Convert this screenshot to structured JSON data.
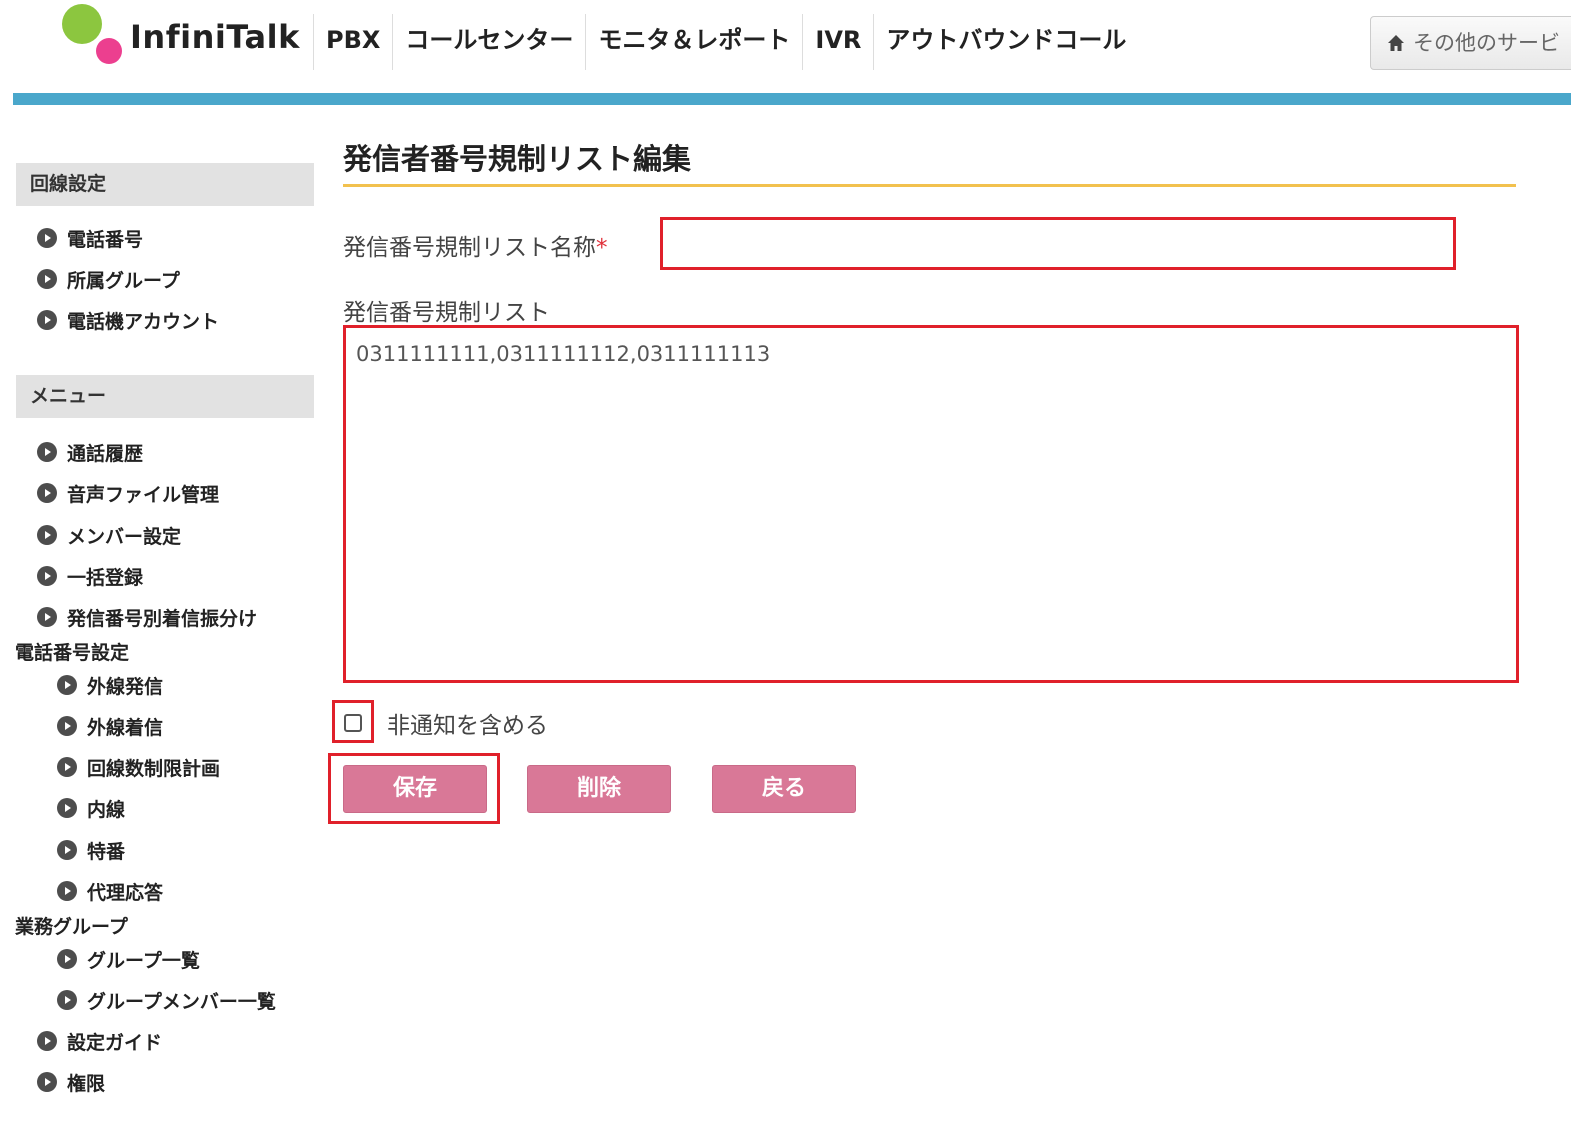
{
  "header": {
    "logo_text": "InfiniTalk",
    "nav": [
      "PBX",
      "コールセンター",
      "モニタ＆レポート",
      "IVR",
      "アウトバウンドコール"
    ],
    "service_button": "その他のサービ"
  },
  "sidebar": {
    "section1": {
      "title": "回線設定",
      "items": [
        "電話番号",
        "所属グループ",
        "電話機アカウント"
      ]
    },
    "section2": {
      "title": "メニュー",
      "items": [
        "通話履歴",
        "音声ファイル管理",
        "メンバー設定",
        "一括登録",
        "発信番号別着信振分け"
      ],
      "group1": {
        "title": "電話番号設定",
        "items": [
          "外線発信",
          "外線着信",
          "回線数制限計画",
          "内線",
          "特番",
          "代理応答"
        ]
      },
      "group2": {
        "title": "業務グループ",
        "items": [
          "グループ一覧",
          "グループメンバー一覧"
        ]
      },
      "tail_items": [
        "設定ガイド",
        "権限"
      ]
    }
  },
  "main": {
    "title": "発信者番号規制リスト編集",
    "name_label": "発信番号規制リスト名称",
    "required_mark": "*",
    "name_value": "",
    "list_label": "発信番号規制リスト",
    "list_value": "0311111111,0311111112,0311111113",
    "checkbox_label": "非通知を含める",
    "checkbox_checked": false,
    "buttons": {
      "save": "保存",
      "delete": "削除",
      "back": "戻る"
    }
  },
  "colors": {
    "accent_blue": "#4aa7cb",
    "button_pink": "#d97897",
    "highlight_red": "#e0202a",
    "title_underline": "#f2c14e"
  }
}
